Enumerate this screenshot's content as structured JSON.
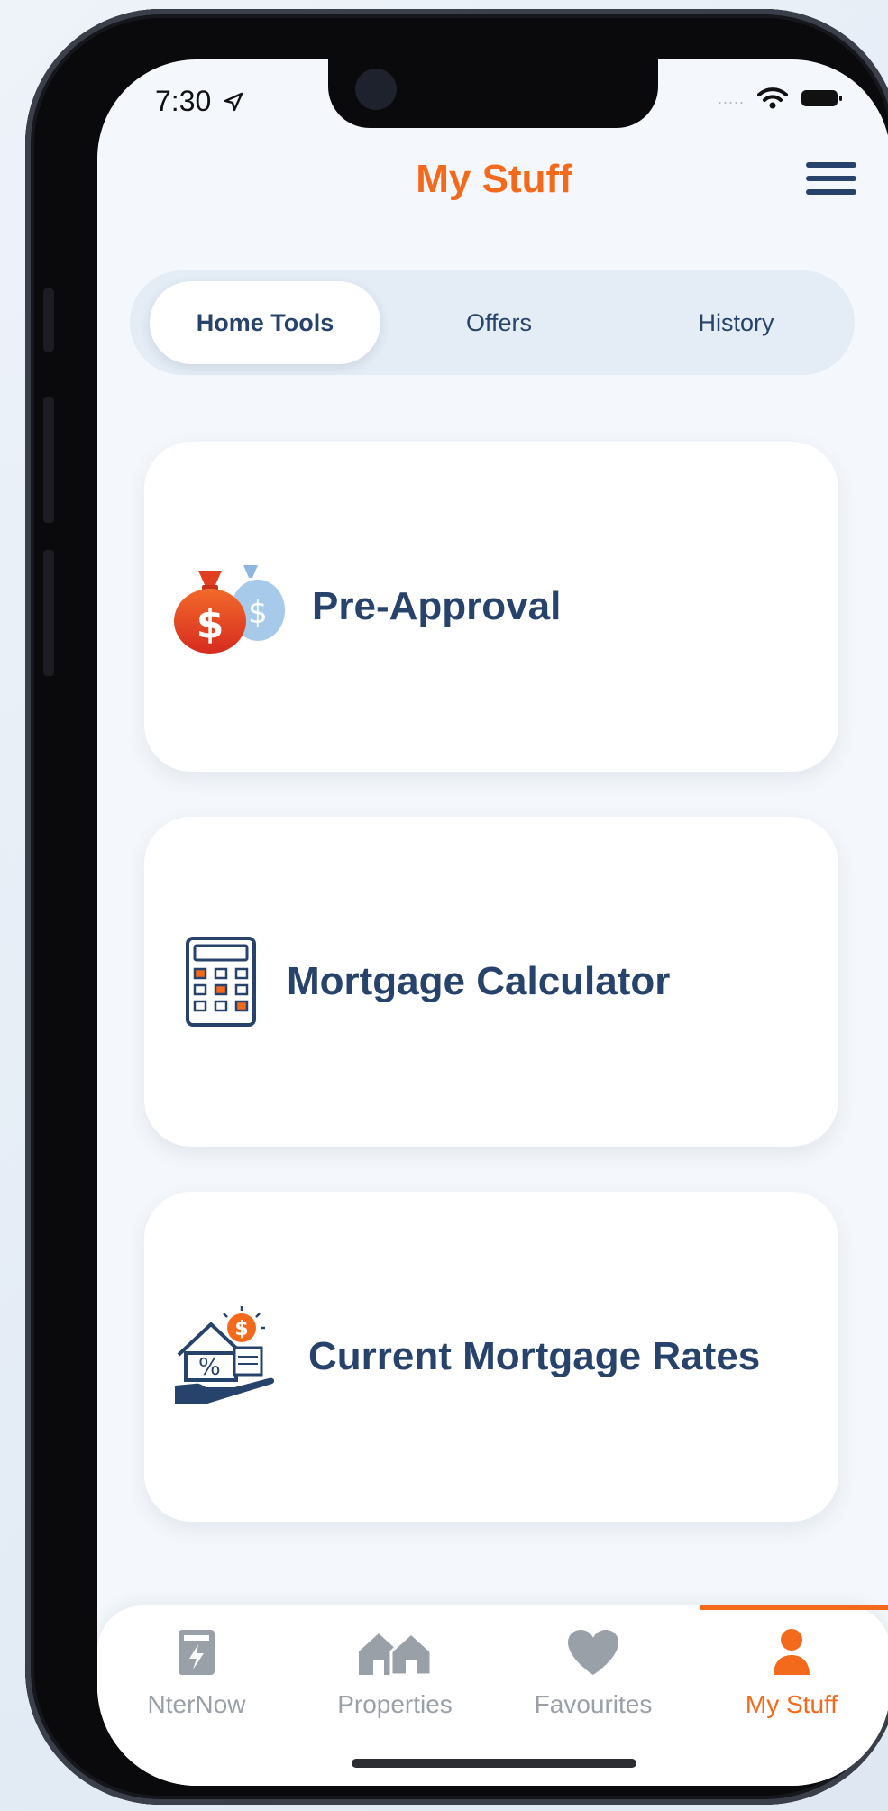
{
  "status_bar": {
    "time": "7:30",
    "signal": "....."
  },
  "header": {
    "title": "My Stuff"
  },
  "segments": [
    "Home Tools",
    "Offers",
    "History"
  ],
  "cards": [
    {
      "label": "Pre-Approval",
      "icon": "money-bags-icon"
    },
    {
      "label": "Mortgage Calculator",
      "icon": "calculator-icon"
    },
    {
      "label": "Current Mortgage Rates",
      "icon": "house-rates-icon"
    }
  ],
  "tabbar": [
    {
      "label": "NterNow",
      "icon": "phone-icon"
    },
    {
      "label": "Properties",
      "icon": "houses-icon"
    },
    {
      "label": "Favourites",
      "icon": "heart-icon"
    },
    {
      "label": "My Stuff",
      "icon": "person-icon"
    }
  ],
  "colors": {
    "accent": "#f36a1d",
    "navy": "#27426b",
    "inactive": "#9aa0a8",
    "background": "#f4f8fc"
  }
}
